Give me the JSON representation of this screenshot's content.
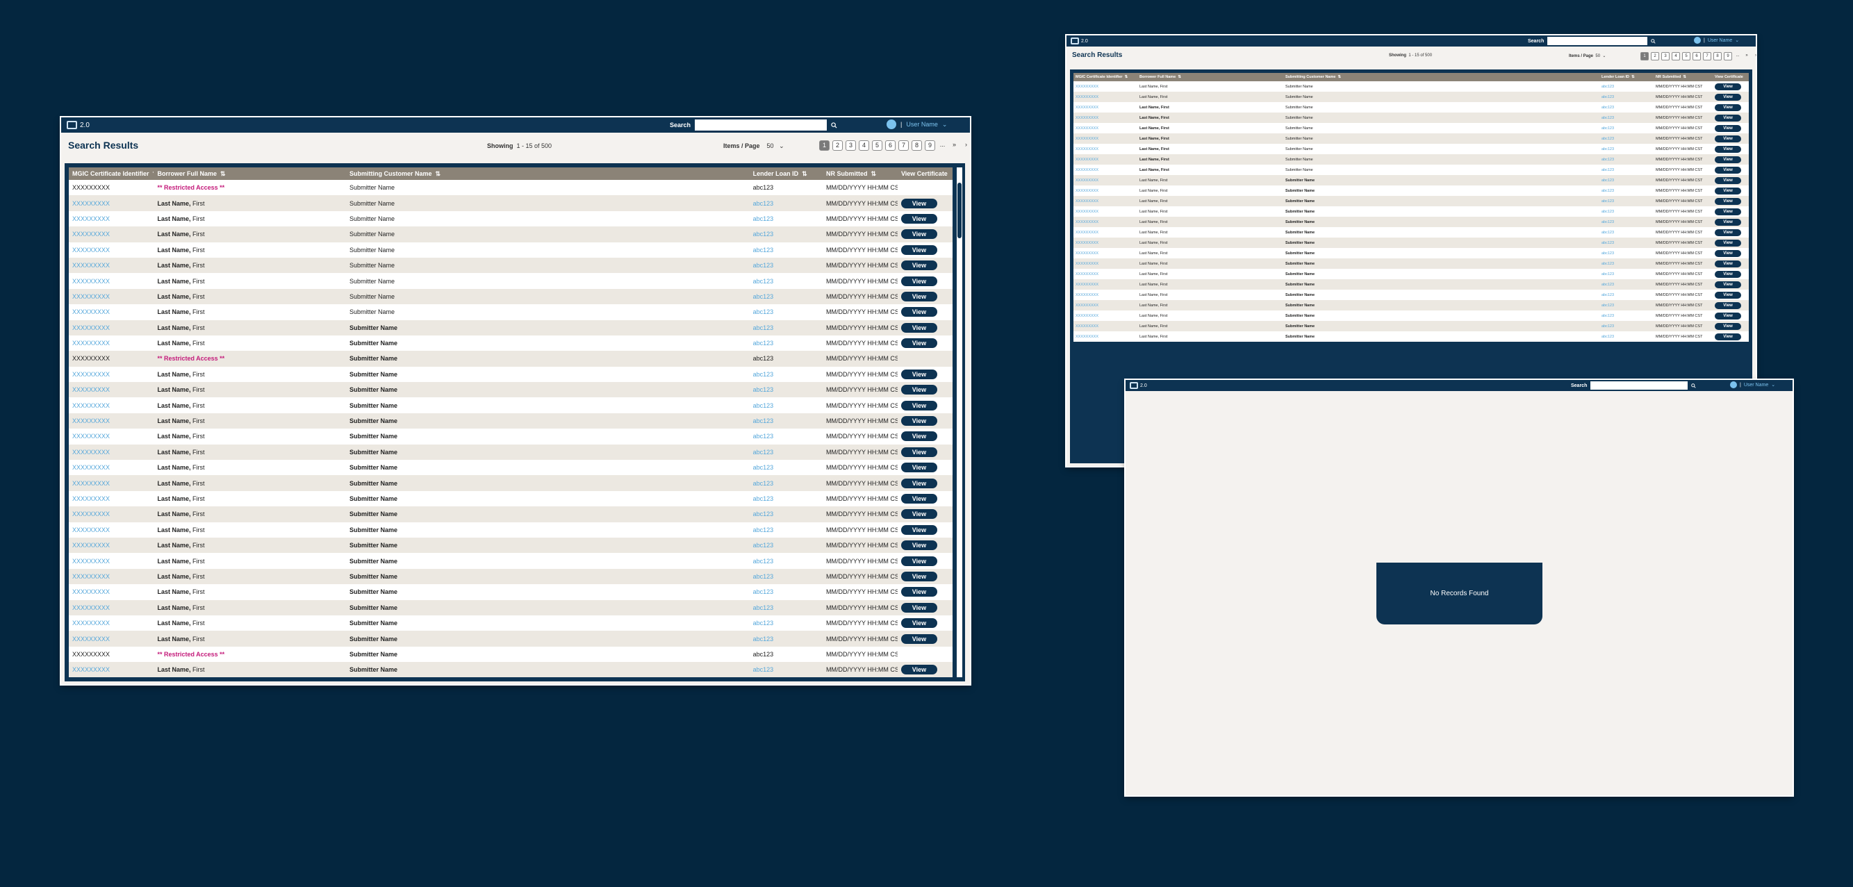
{
  "app": {
    "version": "2.0"
  },
  "search": {
    "label": "Search",
    "value": ""
  },
  "user": {
    "name": "User Name"
  },
  "results": {
    "title": "Search Results",
    "showing_label": "Showing",
    "showing_range": "1 - 15 of  500",
    "items_per_page_label": "Items / Page",
    "items_per_page_value": "50"
  },
  "pagination": {
    "pages": [
      "1",
      "2",
      "3",
      "4",
      "5",
      "6",
      "7",
      "8",
      "9",
      "...",
      "»",
      "›"
    ],
    "active": "1"
  },
  "columns": [
    "MGIC Certificate Identifier",
    "Borrower Full Name",
    "Submitting Customer Name",
    "Lender Loan ID",
    "NR Submitted",
    "View Certificate"
  ],
  "rows": [
    {
      "cert": "XXXXXXXXX",
      "borrower": "** Restricted Access **",
      "submitter": "Submitter Name",
      "loan": "abc123",
      "submitted": "MM/DD/YYYY HH:MM CST",
      "restricted": true,
      "bold_sub": false
    },
    {
      "cert": "XXXXXXXXX",
      "borrower": "Last Name, First",
      "submitter": "Submitter Name",
      "loan": "abc123",
      "submitted": "MM/DD/YYYY HH:MM CST",
      "restricted": false,
      "bold_sub": false
    },
    {
      "cert": "XXXXXXXXX",
      "borrower": "Last Name, First",
      "submitter": "Submitter Name",
      "loan": "abc123",
      "submitted": "MM/DD/YYYY HH:MM CST",
      "restricted": false,
      "bold_sub": false
    },
    {
      "cert": "XXXXXXXXX",
      "borrower": "Last Name, First",
      "submitter": "Submitter Name",
      "loan": "abc123",
      "submitted": "MM/DD/YYYY HH:MM CST",
      "restricted": false,
      "bold_sub": false
    },
    {
      "cert": "XXXXXXXXX",
      "borrower": "Last Name, First",
      "submitter": "Submitter Name",
      "loan": "abc123",
      "submitted": "MM/DD/YYYY HH:MM CST",
      "restricted": false,
      "bold_sub": false
    },
    {
      "cert": "XXXXXXXXX",
      "borrower": "Last Name, First",
      "submitter": "Submitter Name",
      "loan": "abc123",
      "submitted": "MM/DD/YYYY HH:MM CST",
      "restricted": false,
      "bold_sub": false
    },
    {
      "cert": "XXXXXXXXX",
      "borrower": "Last Name, First",
      "submitter": "Submitter Name",
      "loan": "abc123",
      "submitted": "MM/DD/YYYY HH:MM CST",
      "restricted": false,
      "bold_sub": false
    },
    {
      "cert": "XXXXXXXXX",
      "borrower": "Last Name, First",
      "submitter": "Submitter Name",
      "loan": "abc123",
      "submitted": "MM/DD/YYYY HH:MM CST",
      "restricted": false,
      "bold_sub": false
    },
    {
      "cert": "XXXXXXXXX",
      "borrower": "Last Name, First",
      "submitter": "Submitter Name",
      "loan": "abc123",
      "submitted": "MM/DD/YYYY HH:MM CST",
      "restricted": false,
      "bold_sub": false
    },
    {
      "cert": "XXXXXXXXX",
      "borrower": "Last Name, First",
      "submitter": "Submitter Name",
      "loan": "abc123",
      "submitted": "MM/DD/YYYY HH:MM CST",
      "restricted": false,
      "bold_sub": true
    },
    {
      "cert": "XXXXXXXXX",
      "borrower": "Last Name, First",
      "submitter": "Submitter Name",
      "loan": "abc123",
      "submitted": "MM/DD/YYYY HH:MM CST",
      "restricted": false,
      "bold_sub": true
    },
    {
      "cert": "XXXXXXXXX",
      "borrower": "** Restricted Access **",
      "submitter": "Submitter Name",
      "loan": "abc123",
      "submitted": "MM/DD/YYYY HH:MM CST",
      "restricted": true,
      "bold_sub": true
    },
    {
      "cert": "XXXXXXXXX",
      "borrower": "Last Name, First",
      "submitter": "Submitter Name",
      "loan": "abc123",
      "submitted": "MM/DD/YYYY HH:MM CST",
      "restricted": false,
      "bold_sub": true
    },
    {
      "cert": "XXXXXXXXX",
      "borrower": "Last Name, First",
      "submitter": "Submitter Name",
      "loan": "abc123",
      "submitted": "MM/DD/YYYY HH:MM CST",
      "restricted": false,
      "bold_sub": true
    },
    {
      "cert": "XXXXXXXXX",
      "borrower": "Last Name, First",
      "submitter": "Submitter Name",
      "loan": "abc123",
      "submitted": "MM/DD/YYYY HH:MM CST",
      "restricted": false,
      "bold_sub": true
    },
    {
      "cert": "XXXXXXXXX",
      "borrower": "Last Name, First",
      "submitter": "Submitter Name",
      "loan": "abc123",
      "submitted": "MM/DD/YYYY HH:MM CST",
      "restricted": false,
      "bold_sub": true
    },
    {
      "cert": "XXXXXXXXX",
      "borrower": "Last Name, First",
      "submitter": "Submitter Name",
      "loan": "abc123",
      "submitted": "MM/DD/YYYY HH:MM CST",
      "restricted": false,
      "bold_sub": true
    },
    {
      "cert": "XXXXXXXXX",
      "borrower": "Last Name, First",
      "submitter": "Submitter Name",
      "loan": "abc123",
      "submitted": "MM/DD/YYYY HH:MM CST",
      "restricted": false,
      "bold_sub": true
    },
    {
      "cert": "XXXXXXXXX",
      "borrower": "Last Name, First",
      "submitter": "Submitter Name",
      "loan": "abc123",
      "submitted": "MM/DD/YYYY HH:MM CST",
      "restricted": false,
      "bold_sub": true
    },
    {
      "cert": "XXXXXXXXX",
      "borrower": "Last Name, First",
      "submitter": "Submitter Name",
      "loan": "abc123",
      "submitted": "MM/DD/YYYY HH:MM CST",
      "restricted": false,
      "bold_sub": true
    },
    {
      "cert": "XXXXXXXXX",
      "borrower": "Last Name, First",
      "submitter": "Submitter Name",
      "loan": "abc123",
      "submitted": "MM/DD/YYYY HH:MM CST",
      "restricted": false,
      "bold_sub": true
    },
    {
      "cert": "XXXXXXXXX",
      "borrower": "Last Name, First",
      "submitter": "Submitter Name",
      "loan": "abc123",
      "submitted": "MM/DD/YYYY HH:MM CST",
      "restricted": false,
      "bold_sub": true
    },
    {
      "cert": "XXXXXXXXX",
      "borrower": "Last Name, First",
      "submitter": "Submitter Name",
      "loan": "abc123",
      "submitted": "MM/DD/YYYY HH:MM CST",
      "restricted": false,
      "bold_sub": true
    },
    {
      "cert": "XXXXXXXXX",
      "borrower": "Last Name, First",
      "submitter": "Submitter Name",
      "loan": "abc123",
      "submitted": "MM/DD/YYYY HH:MM CST",
      "restricted": false,
      "bold_sub": true
    },
    {
      "cert": "XXXXXXXXX",
      "borrower": "Last Name, First",
      "submitter": "Submitter Name",
      "loan": "abc123",
      "submitted": "MM/DD/YYYY HH:MM CST",
      "restricted": false,
      "bold_sub": true
    },
    {
      "cert": "XXXXXXXXX",
      "borrower": "Last Name, First",
      "submitter": "Submitter Name",
      "loan": "abc123",
      "submitted": "MM/DD/YYYY HH:MM CST",
      "restricted": false,
      "bold_sub": true
    },
    {
      "cert": "XXXXXXXXX",
      "borrower": "Last Name, First",
      "submitter": "Submitter Name",
      "loan": "abc123",
      "submitted": "MM/DD/YYYY HH:MM CST",
      "restricted": false,
      "bold_sub": true
    },
    {
      "cert": "XXXXXXXXX",
      "borrower": "Last Name, First",
      "submitter": "Submitter Name",
      "loan": "abc123",
      "submitted": "MM/DD/YYYY HH:MM CST",
      "restricted": false,
      "bold_sub": true
    },
    {
      "cert": "XXXXXXXXX",
      "borrower": "Last Name, First",
      "submitter": "Submitter Name",
      "loan": "abc123",
      "submitted": "MM/DD/YYYY HH:MM CST",
      "restricted": false,
      "bold_sub": true
    },
    {
      "cert": "XXXXXXXXX",
      "borrower": "Last Name, First",
      "submitter": "Submitter Name",
      "loan": "abc123",
      "submitted": "MM/DD/YYYY HH:MM CST",
      "restricted": false,
      "bold_sub": true
    },
    {
      "cert": "XXXXXXXXX",
      "borrower": "** Restricted Access **",
      "submitter": "Submitter Name",
      "loan": "abc123",
      "submitted": "MM/DD/YYYY HH:MM CST",
      "restricted": true,
      "bold_sub": true
    },
    {
      "cert": "XXXXXXXXX",
      "borrower": "Last Name, First",
      "submitter": "Submitter Name",
      "loan": "abc123",
      "submitted": "MM/DD/YYYY HH:MM CST",
      "restricted": false,
      "bold_sub": true
    }
  ],
  "small_rows": [
    {
      "borrower": "Last Name, First",
      "bold_borrower": false,
      "submitter": "Submitter Name",
      "bold_sub": false
    },
    {
      "borrower": "Last Name, First",
      "bold_borrower": false,
      "submitter": "Submitter Name",
      "bold_sub": false
    },
    {
      "borrower": "Last Name, First",
      "bold_borrower": true,
      "submitter": "Submitter Name",
      "bold_sub": false
    },
    {
      "borrower": "Last Name, First",
      "bold_borrower": true,
      "submitter": "Submitter Name",
      "bold_sub": false
    },
    {
      "borrower": "Last Name, First",
      "bold_borrower": true,
      "submitter": "Submitter Name",
      "bold_sub": false
    },
    {
      "borrower": "Last Name, First",
      "bold_borrower": true,
      "submitter": "Submitter Name",
      "bold_sub": false
    },
    {
      "borrower": "Last Name, First",
      "bold_borrower": true,
      "submitter": "Submitter Name",
      "bold_sub": false
    },
    {
      "borrower": "Last Name, First",
      "bold_borrower": true,
      "submitter": "Submitter Name",
      "bold_sub": false
    },
    {
      "borrower": "Last Name, First",
      "bold_borrower": true,
      "submitter": "Submitter Name",
      "bold_sub": false
    },
    {
      "borrower": "Last Name, First",
      "bold_borrower": false,
      "submitter": "Submitter Name",
      "bold_sub": true
    },
    {
      "borrower": "Last Name, First",
      "bold_borrower": false,
      "submitter": "Submitter Name",
      "bold_sub": true
    },
    {
      "borrower": "Last Name, First",
      "bold_borrower": false,
      "submitter": "Submitter Name",
      "bold_sub": true
    },
    {
      "borrower": "Last Name, First",
      "bold_borrower": false,
      "submitter": "Submitter Name",
      "bold_sub": true
    },
    {
      "borrower": "Last Name, First",
      "bold_borrower": false,
      "submitter": "Submitter Name",
      "bold_sub": true
    },
    {
      "borrower": "Last Name, First",
      "bold_borrower": false,
      "submitter": "Submitter Name",
      "bold_sub": true
    },
    {
      "borrower": "Last Name, First",
      "bold_borrower": false,
      "submitter": "Submitter Name",
      "bold_sub": true
    },
    {
      "borrower": "Last Name, First",
      "bold_borrower": false,
      "submitter": "Submitter Name",
      "bold_sub": true
    },
    {
      "borrower": "Last Name, First",
      "bold_borrower": false,
      "submitter": "Submitter Name",
      "bold_sub": true
    },
    {
      "borrower": "Last Name, First",
      "bold_borrower": false,
      "submitter": "Submitter Name",
      "bold_sub": true
    },
    {
      "borrower": "Last Name, First",
      "bold_borrower": false,
      "submitter": "Submitter Name",
      "bold_sub": true
    },
    {
      "borrower": "Last Name, First",
      "bold_borrower": false,
      "submitter": "Submitter Name",
      "bold_sub": true
    },
    {
      "borrower": "Last Name, First",
      "bold_borrower": false,
      "submitter": "Submitter Name",
      "bold_sub": true
    },
    {
      "borrower": "Last Name, First",
      "bold_borrower": false,
      "submitter": "Submitter Name",
      "bold_sub": true
    },
    {
      "borrower": "Last Name, First",
      "bold_borrower": false,
      "submitter": "Submitter Name",
      "bold_sub": true
    },
    {
      "borrower": "Last Name, First",
      "bold_borrower": false,
      "submitter": "Submitter Name",
      "bold_sub": true
    }
  ],
  "small_common": {
    "cert": "XXXXXXXXX",
    "loan": "abc123",
    "submitted": "MM/DD/YYYY HH:MM CST"
  },
  "view_label": "View",
  "empty_state": {
    "message": "No Records Found"
  },
  "colors": {
    "background": "#04263f",
    "header": "#0d3352",
    "accent": "#55a7db",
    "restricted": "#c41a7a",
    "table_header": "#8b8377"
  },
  "icons": {
    "logo": "logo-icon",
    "search": "search-icon",
    "user": "user-avatar-icon",
    "chevron": "chevron-down-icon",
    "sort": "sort-icon"
  }
}
